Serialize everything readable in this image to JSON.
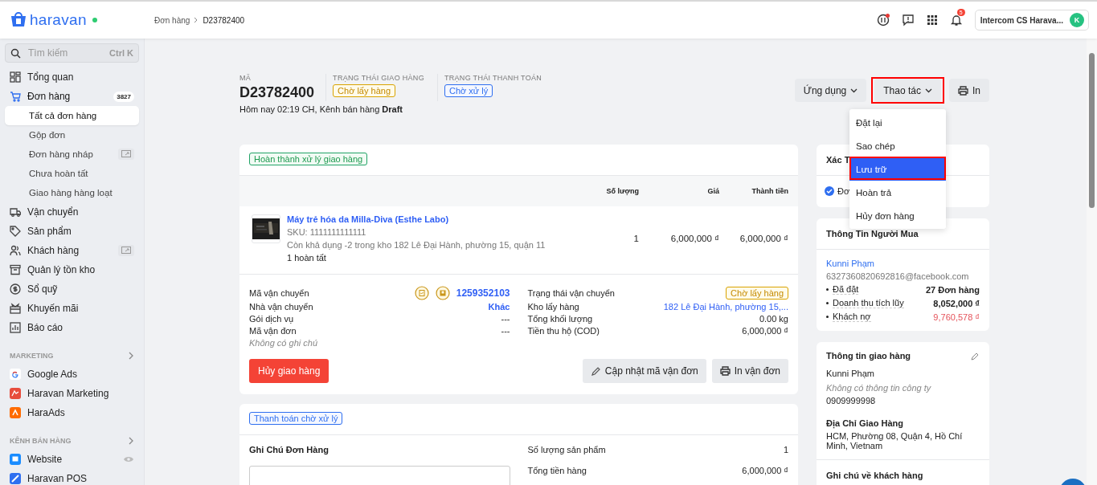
{
  "topbar": {
    "logo": "haravan",
    "online": true,
    "breadcrumb": [
      {
        "label": "Đơn hàng",
        "kind": "link"
      },
      {
        "label": "D23782400",
        "kind": "current"
      }
    ],
    "notification_count": "5",
    "account": "Intercom CS Harava...",
    "avatar": "K"
  },
  "sidebar": {
    "search": {
      "placeholder": "Tìm kiếm",
      "shortcut": "Ctrl K"
    },
    "items": [
      {
        "label": "Tổng quan",
        "selected": false
      },
      {
        "label": "Đơn hàng",
        "badge": "3827",
        "selected": true,
        "children": [
          {
            "label": "Tất cả đơn hàng",
            "selected": true
          },
          {
            "label": "Gộp đơn",
            "selected": false
          },
          {
            "label": "Đơn hàng nháp",
            "selected": false,
            "external": true
          },
          {
            "label": "Chưa hoàn tất",
            "selected": false
          },
          {
            "label": "Giao hàng hàng loạt",
            "selected": false
          }
        ]
      },
      {
        "label": "Vận chuyển",
        "selected": false
      },
      {
        "label": "Sản phẩm",
        "selected": false
      },
      {
        "label": "Khách hàng",
        "selected": false,
        "external": true
      },
      {
        "label": "Quản lý tồn kho",
        "selected": false
      },
      {
        "label": "Sổ quỹ",
        "selected": false
      },
      {
        "label": "Khuyến mãi",
        "selected": false
      },
      {
        "label": "Báo cáo",
        "selected": false
      }
    ],
    "sections": [
      {
        "title": "MARKETING",
        "items": [
          {
            "label": "Google Ads"
          },
          {
            "label": "Haravan Marketing"
          },
          {
            "label": "HaraAds"
          }
        ]
      },
      {
        "title": "KÊNH BÁN HÀNG",
        "items": [
          {
            "label": "Website",
            "eye": true
          },
          {
            "label": "Haravan POS"
          }
        ]
      }
    ]
  },
  "order": {
    "code_label": "MÃ",
    "code": "D23782400",
    "statuses": [
      {
        "label": "TRẠNG THÁI GIAO HÀNG",
        "badge": "Chờ lấy hàng",
        "kind": "warning"
      },
      {
        "label": "TRẠNG THÁI THANH TOÁN",
        "badge": "Chờ xử lý",
        "kind": "info"
      }
    ],
    "meta": "Hôm nay 02:19 CH, Kênh bán hàng  **Draft**"
  },
  "actions": [
    {
      "label": "Ứng dụng",
      "kind": "dropdown",
      "highlighted": false
    },
    {
      "label": "Thao tác",
      "kind": "dropdown",
      "highlighted": true
    },
    {
      "label": "In",
      "kind": "print",
      "highlighted": false
    }
  ],
  "action_menu": [
    {
      "label": "Đặt lại",
      "selected": false
    },
    {
      "label": "Sao chép",
      "selected": false
    },
    {
      "label": "Lưu trữ",
      "selected": true
    },
    {
      "label": "Hoàn trả",
      "selected": false
    },
    {
      "label": "Hủy đơn hàng",
      "selected": false
    }
  ],
  "fulfillment": {
    "tag": {
      "label": "Hoàn thành xử lý giao hàng",
      "kind": "success"
    },
    "columns": [
      "Số lượng",
      "Giá",
      "Thành tiền"
    ],
    "line_item": {
      "name": "Máy trẻ hóa da Milla-Diva (Esthe Labo)",
      "sku": "SKU: 1111111111111",
      "stock": "Còn khả dụng -2 trong kho 182 Lê Đại Hành, phường 15, quận 11",
      "status": "1 hoàn tất",
      "quantity": "1",
      "price": "6,000,000 ₫",
      "total": "6,000,000 ₫"
    },
    "shipping_left": [
      {
        "label": "Mã vận chuyển",
        "value": "1259352103",
        "kind": "tracking"
      },
      {
        "label": "Nhà vận chuyển",
        "value": "Khác",
        "kind": "link"
      },
      {
        "label": "Gói dịch vụ",
        "value": "---",
        "kind": "plain"
      },
      {
        "label": "Mã vận đơn",
        "value": "---",
        "kind": "plain"
      }
    ],
    "note": "Không có ghi chú",
    "shipping_right": [
      {
        "label": "Trạng thái vận chuyển",
        "value": "Chờ lấy hàng",
        "kind": "badge"
      },
      {
        "label": "Kho lấy hàng",
        "value": "182 Lê Đại Hành, phường 15,...",
        "kind": "link"
      },
      {
        "label": "Tổng khối lượng",
        "value": "0.00 kg",
        "kind": "plain"
      },
      {
        "label": "Tiền thu hộ (COD)",
        "value": "6,000,000 ₫",
        "kind": "plain"
      }
    ],
    "buttons": [
      {
        "label": "Hủy giao hàng",
        "kind": "danger"
      },
      {
        "label": "Cập nhật mã vận đơn",
        "kind": "edit"
      },
      {
        "label": "In vận đơn",
        "kind": "print"
      }
    ]
  },
  "payment": {
    "tag": {
      "label": "Thanh toán chờ xử lý",
      "kind": "info"
    },
    "note_title": "Ghi Chú Đơn Hàng",
    "rows": [
      {
        "label": "Số lượng sản phẩm",
        "value": "1"
      },
      {
        "label": "Tổng tiền hàng",
        "value": "6,000,000 ₫"
      }
    ]
  },
  "verification": {
    "title": "Xác T",
    "line": "Đơ",
    "checked": true
  },
  "buyer": {
    "title": "Thông Tin Người Mua",
    "name": "Kunni Phạm",
    "email": "6327360820692816@facebook.com",
    "stats": [
      {
        "label": "Đã đặt",
        "value": "27 Đơn hàng",
        "kind": "bold"
      },
      {
        "label": "Doanh thu tích lũy",
        "value": "8,052,000 ₫",
        "kind": "bold"
      },
      {
        "label": "Khách nợ",
        "value": "9,760,578 ₫",
        "kind": "debt"
      }
    ]
  },
  "shipping_info": {
    "title": "Thông tin giao hàng",
    "name": "Kunni Phạm",
    "company": "Không có thông tin công ty",
    "phone": "0909999998",
    "address_title": "Địa Chỉ Giao Hàng",
    "address": "HCM, Phường 08, Quận 4, Hồ Chí Minh, Vietnam"
  },
  "customer_note": {
    "title": "Ghi chú về khách hàng"
  }
}
